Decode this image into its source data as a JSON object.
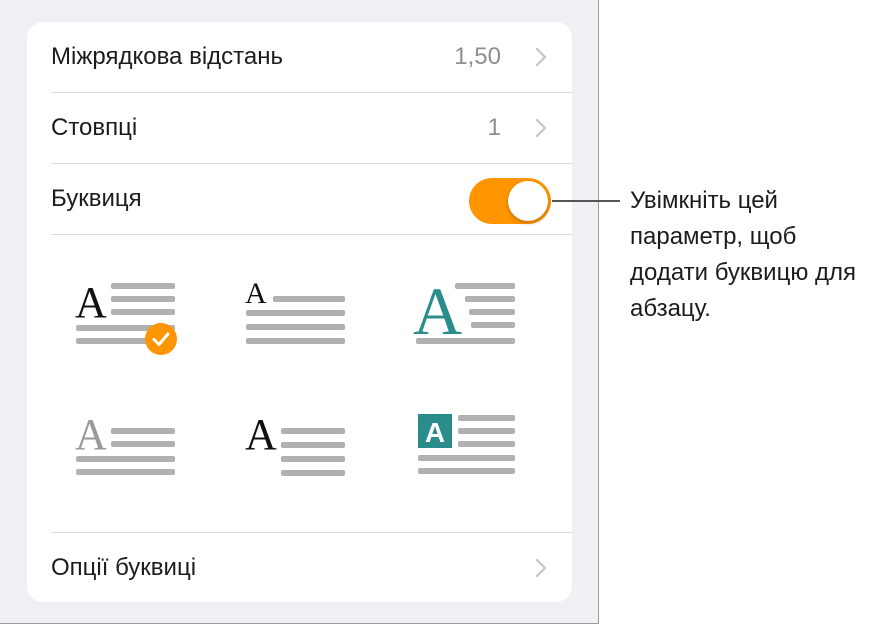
{
  "rows": {
    "line_spacing": {
      "label": "Міжрядкова відстань",
      "value": "1,50"
    },
    "columns": {
      "label": "Стовпці",
      "value": "1"
    },
    "drop_cap": {
      "label": "Буквиця",
      "enabled": true
    },
    "drop_cap_options": {
      "label": "Опції буквиці"
    }
  },
  "drop_cap_styles": [
    {
      "letter": "A",
      "selected": true
    },
    {
      "letter": "A",
      "selected": false
    },
    {
      "letter": "A",
      "selected": false
    },
    {
      "letter": "A",
      "selected": false
    },
    {
      "letter": "A",
      "selected": false
    },
    {
      "letter": "A",
      "selected": false
    }
  ],
  "callout": {
    "text": "Увімкніть цей параметр, щоб додати буквицю для абзацу."
  },
  "colors": {
    "accent": "#ff9500",
    "teal": "#2b8c8c",
    "line_gray": "#b1b1b1",
    "text": "#1c1c1e",
    "secondary": "#8e8e93"
  },
  "icons": {
    "chevron": "chevron-right-icon",
    "check": "checkmark-icon"
  }
}
